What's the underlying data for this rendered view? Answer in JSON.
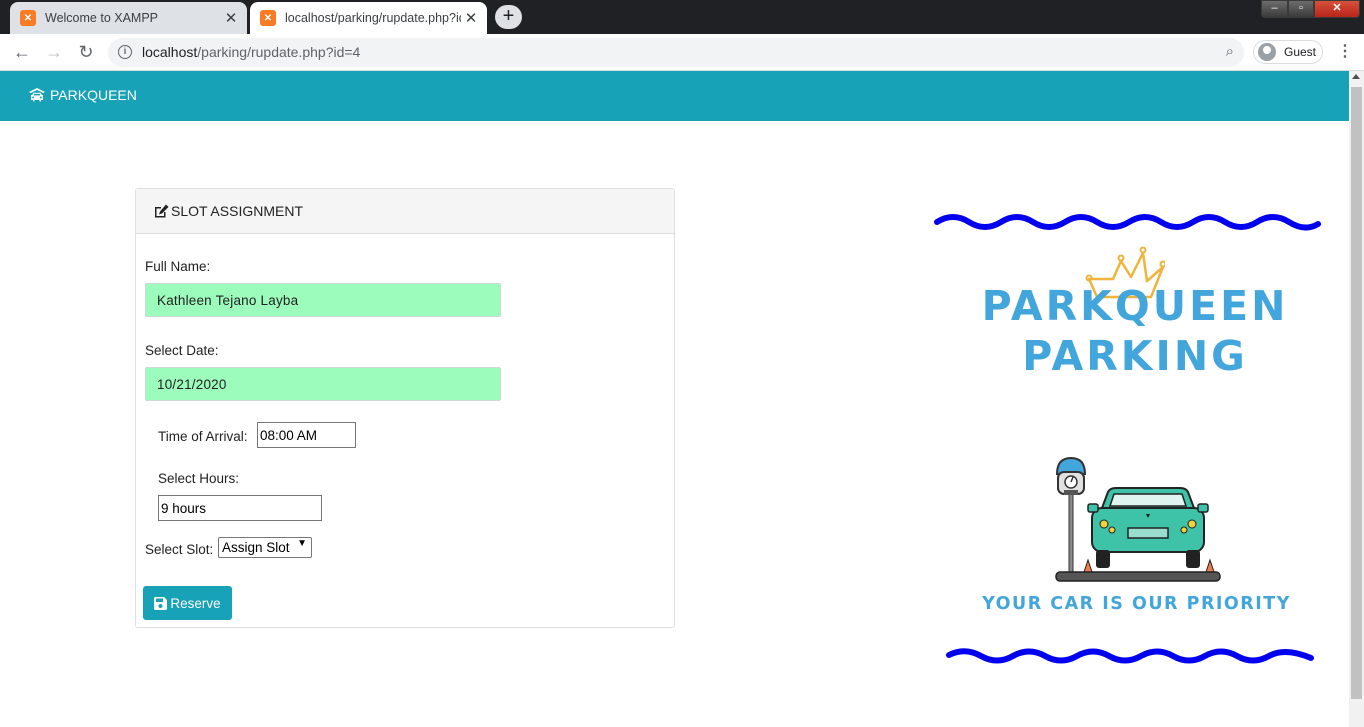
{
  "browser": {
    "tabs": [
      {
        "title": "Welcome to XAMPP",
        "active": false
      },
      {
        "title": "localhost/parking/rupdate.php?id=4",
        "active": true
      }
    ],
    "url_host": "localhost",
    "url_path": "/parking/rupdate.php?id=4",
    "profile_label": "Guest"
  },
  "navbar": {
    "brand": "PARKQUEEN",
    "color": "#17a2b8"
  },
  "form": {
    "header": "SLOT ASSIGNMENT",
    "full_name_label": "Full Name:",
    "full_name_value": "Kathleen Tejano Layba",
    "date_label": "Select Date:",
    "date_value": "10/21/2020",
    "arrival_label": "Time of Arrival:",
    "arrival_value": "08:00 AM",
    "hours_label": "Select Hours:",
    "hours_value": "9 hours",
    "slot_label": "Select Slot:",
    "slot_selected": "Assign Slot",
    "submit_label": "Reserve"
  },
  "logo": {
    "line1": "PARKQUEEN",
    "line2": "PARKING",
    "tagline": "YOUR CAR IS OUR PRIORITY",
    "text_color": "#42a6dc",
    "wave_color": "#0000ee"
  },
  "icons": {
    "brand": "car-icon",
    "header": "edit-icon",
    "submit": "save-icon"
  }
}
